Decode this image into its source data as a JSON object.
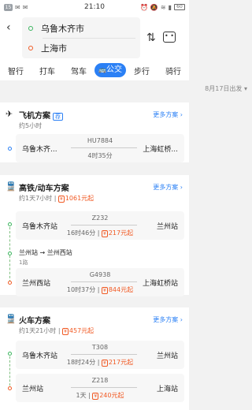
{
  "status": {
    "left_badge": "15",
    "time": "21:10",
    "battery": "60"
  },
  "route": {
    "from": "乌鲁木齐市",
    "to": "上海市"
  },
  "tabs": [
    "智行",
    "打车",
    "驾车",
    "公交",
    "步行",
    "骑行"
  ],
  "tab_active_icon": "bus-icon",
  "date": "8月17日出发",
  "plane": {
    "title": "飞机方案",
    "tag": "荐",
    "sub": "约5小时",
    "more": "更多方案",
    "seg": {
      "from": "乌鲁木齐...",
      "code": "HU7884",
      "to": "上海虹桥...",
      "info": "4时35分"
    }
  },
  "train1": {
    "title": "高铁/动车方案",
    "sub_a": "约1天7小时",
    "sub_price": "1061元起",
    "more": "更多方案",
    "seg1": {
      "from": "乌鲁木齐站",
      "code": "Z232",
      "to": "兰州站",
      "duration": "16时46分",
      "price": "217元起"
    },
    "transfer": "兰州站 → 兰州西站",
    "transfer_sub": "1路",
    "seg2": {
      "from": "兰州西站",
      "code": "G4938",
      "to": "上海虹桥站",
      "duration": "10时37分",
      "price": "844元起"
    }
  },
  "train2": {
    "title": "火车方案",
    "sub_a": "约1天21小时",
    "sub_price": "457元起",
    "more": "更多方案",
    "seg1": {
      "from": "乌鲁木齐站",
      "code": "T308",
      "to": "兰州站",
      "duration": "18时24分",
      "price": "217元起"
    },
    "seg2": {
      "from": "兰州站",
      "code": "Z218",
      "to": "上海站",
      "duration": "1天",
      "price": "240元起"
    }
  },
  "ticket_mark": "¥",
  "colors": {
    "accent": "#2b80f5",
    "price": "#f15a24",
    "start": "#3bb55e",
    "end": "#f15a24"
  }
}
